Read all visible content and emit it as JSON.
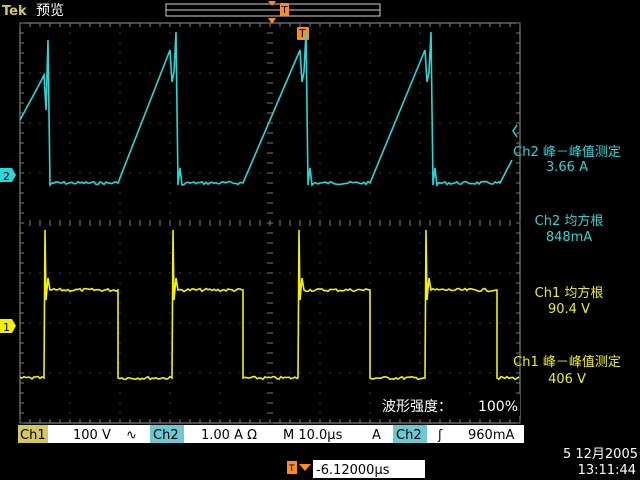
{
  "header": {
    "brand": "Tek",
    "mode": "预览",
    "trigger_marker_label": "T"
  },
  "channel_markers": {
    "ch1": "1",
    "ch2": "2"
  },
  "measurements": [
    {
      "label": "Ch2 峰－峰值测定",
      "value": "3.66 A",
      "channel": "ch2"
    },
    {
      "label": "Ch2 均方根",
      "value": "848mA",
      "channel": "ch2"
    },
    {
      "label": "Ch1 均方根",
      "value": "90.4 V",
      "channel": "ch1"
    },
    {
      "label": "Ch1 峰－峰值测定",
      "value": "406 V",
      "channel": "ch1"
    }
  ],
  "intensity": {
    "label": "波形强度：",
    "value": "100%"
  },
  "status_bar": {
    "ch1_label": "Ch1",
    "ch1_scale": "100 V",
    "ch1_coupling": "∿",
    "ch2_label": "Ch2",
    "ch2_scale": "1.00 A Ω",
    "timebase": "M 10.0µs",
    "trigger_mode": "A",
    "trigger_source": "Ch2",
    "trigger_slope": "ʃ",
    "trigger_level": "960mA"
  },
  "trigger_offset": {
    "value": "-6.12000µs"
  },
  "datetime": {
    "date": "5 12月2005",
    "time": "13:11:44"
  },
  "colors": {
    "ch1": "#f2f200",
    "ch2": "#28d7d7",
    "trigger": "#ff8a1e",
    "grid": "#707070",
    "status_bg": "#d6c860"
  }
}
